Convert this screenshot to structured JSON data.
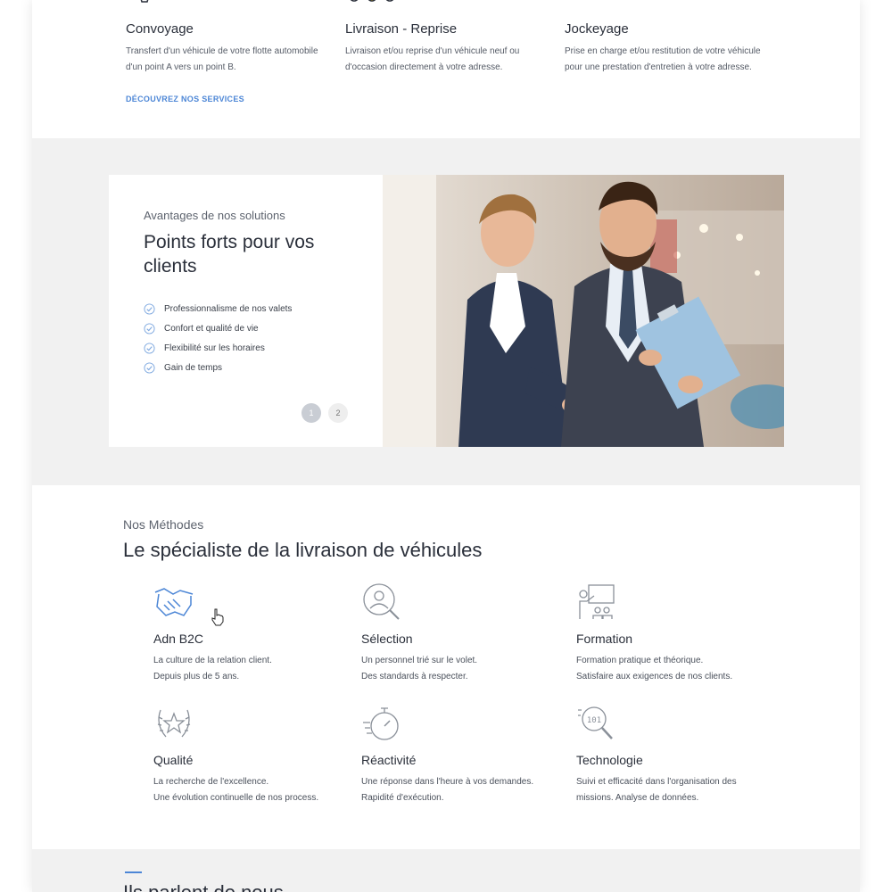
{
  "services": {
    "items": [
      {
        "title": "Convoyage",
        "text": "Transfert d'un véhicule de votre flotte automobile d'un point A vers un point B.",
        "icon": "convoy-icon"
      },
      {
        "title": "Livraison - Reprise",
        "text": "Livraison et/ou reprise d'un véhicule neuf ou d'occasion directement à votre adresse.",
        "icon": "cars-icon"
      },
      {
        "title": "Jockeyage",
        "text": "Prise en charge et/ou restitution de votre véhicule pour une prestation d'entretien à votre adresse.",
        "icon": "car-key-icon"
      }
    ],
    "discover_label": "DÉCOUVREZ NOS SERVICES"
  },
  "advantages": {
    "subtitle": "Avantages de nos solutions",
    "title": "Points forts pour vos clients",
    "items": [
      "Professionnalisme de nos valets",
      "Confort et qualité de vie",
      "Flexibilité sur les horaires",
      "Gain de temps"
    ],
    "pages": [
      "1",
      "2"
    ]
  },
  "methods": {
    "subtitle": "Nos Méthodes",
    "title": "Le spécialiste de la livraison de véhicules",
    "items": [
      {
        "title": "Adn B2C",
        "line1": "La culture de la relation client.",
        "line2": "Depuis plus de 5 ans.",
        "icon": "handshake-icon"
      },
      {
        "title": "Sélection",
        "line1": "Un personnel trié sur le volet.",
        "line2": "Des standards à respecter.",
        "icon": "person-search-icon"
      },
      {
        "title": "Formation",
        "line1": "Formation pratique et théorique.",
        "line2": "Satisfaire aux exigences de nos clients.",
        "icon": "teaching-icon"
      },
      {
        "title": "Qualité",
        "line1": "La recherche de l'excellence.",
        "line2": "Une évolution continuelle de nos process.",
        "icon": "laurel-star-icon"
      },
      {
        "title": "Réactivité",
        "line1": "Une réponse dans l'heure à vos demandes.",
        "line2": "Rapidité d'exécution.",
        "icon": "stopwatch-icon"
      },
      {
        "title": "Technologie",
        "line1": "Suivi et efficacité dans l'organisation des",
        "line2": "missions. Analyse de données.",
        "icon": "data-search-icon"
      }
    ]
  },
  "testimonials": {
    "title": "Ils parlent de nous"
  },
  "colors": {
    "accent": "#4c86d6",
    "icon_yellow": "#f2c500",
    "section_gray": "#f1f1f1"
  }
}
